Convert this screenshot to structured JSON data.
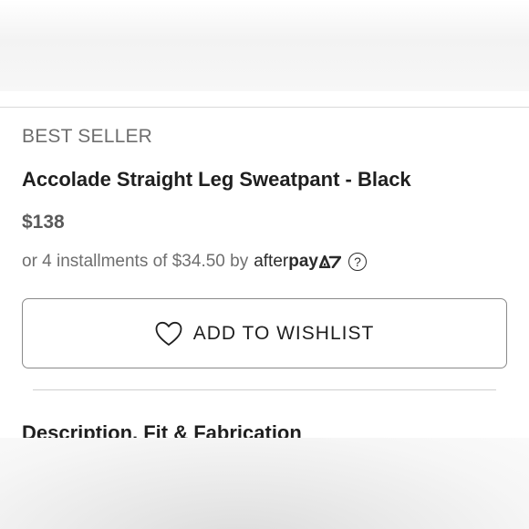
{
  "product": {
    "badge": "BEST SELLER",
    "title": "Accolade Straight Leg Sweatpant - Black",
    "price": "$138"
  },
  "payment": {
    "installments_text": "or 4 installments of $34.50 by",
    "provider_prefix": "after",
    "provider_bold": "pay",
    "help_icon_text": "?"
  },
  "wishlist": {
    "button_label": "ADD TO WISHLIST",
    "icon": "heart-outline-icon"
  },
  "sections": {
    "description_title": "Description, Fit & Fabrication"
  }
}
